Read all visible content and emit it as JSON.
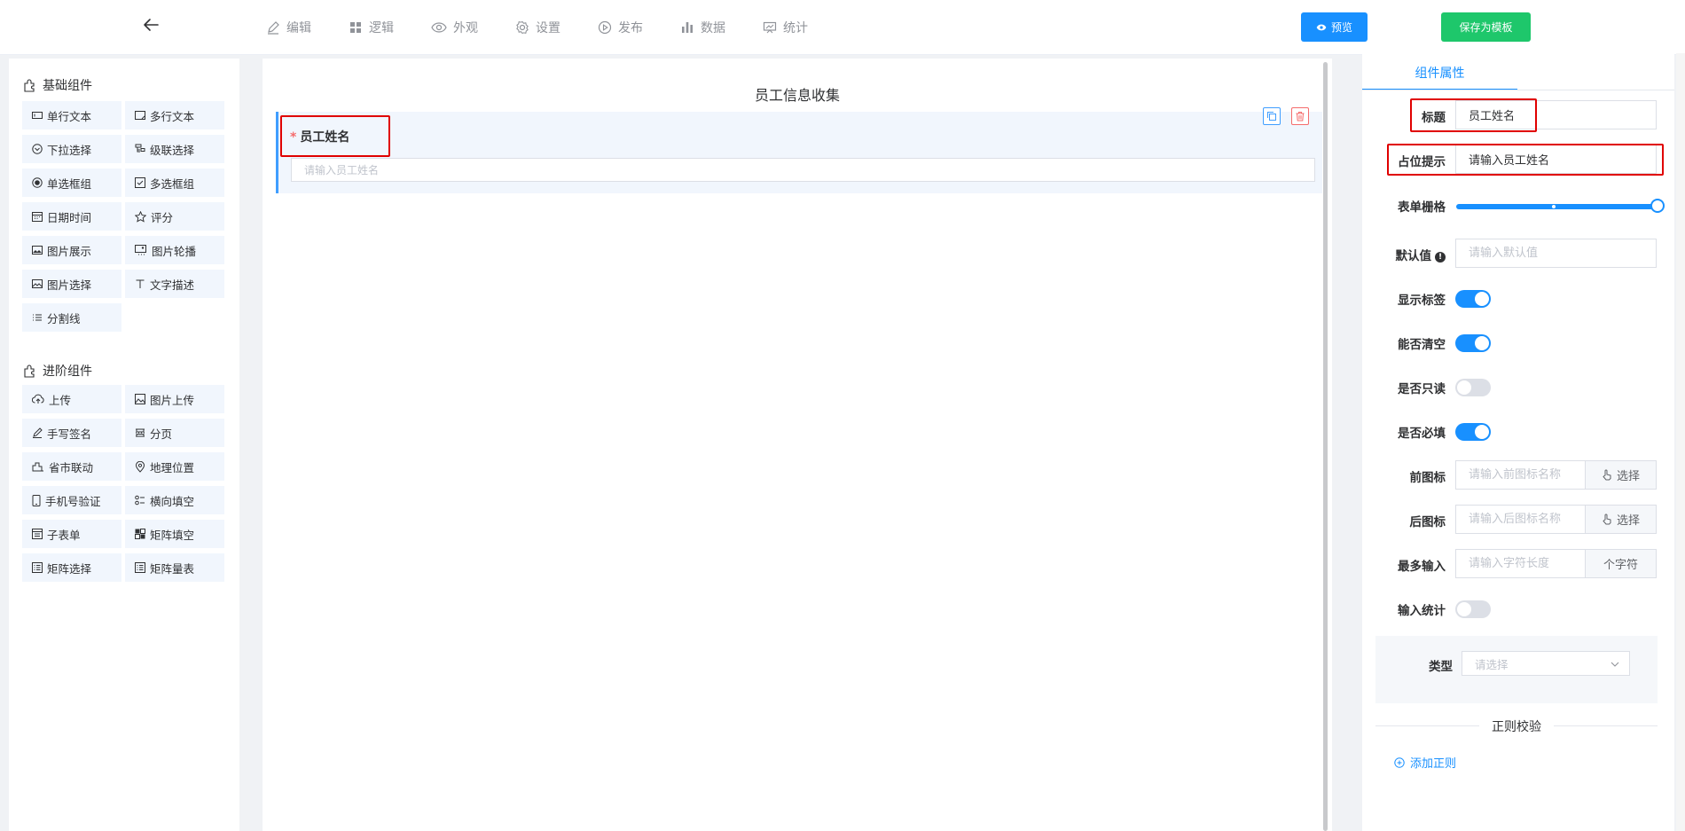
{
  "topbar": {
    "nav": [
      {
        "label": "编辑",
        "icon": "edit-icon"
      },
      {
        "label": "逻辑",
        "icon": "logic-icon"
      },
      {
        "label": "外观",
        "icon": "eye-icon"
      },
      {
        "label": "设置",
        "icon": "gear-icon"
      },
      {
        "label": "发布",
        "icon": "play-icon"
      },
      {
        "label": "数据",
        "icon": "bar-chart-icon"
      },
      {
        "label": "统计",
        "icon": "statistics-icon"
      }
    ],
    "preview_label": "预览",
    "save_template_label": "保存为模板"
  },
  "left_panel": {
    "basic": {
      "title": "基础组件",
      "items": [
        "单行文本",
        "多行文本",
        "下拉选择",
        "级联选择",
        "单选框组",
        "多选框组",
        "日期时间",
        "评分",
        "图片展示",
        "图片轮播",
        "图片选择",
        "文字描述",
        "分割线"
      ]
    },
    "advanced": {
      "title": "进阶组件",
      "items": [
        "上传",
        "图片上传",
        "手写签名",
        "分页",
        "省市联动",
        "地理位置",
        "手机号验证",
        "横向填空",
        "子表单",
        "矩阵填空",
        "矩阵选择",
        "矩阵量表"
      ]
    }
  },
  "canvas": {
    "form_title": "员工信息收集",
    "field": {
      "required_mark": "*",
      "label": "员工姓名",
      "placeholder": "请输入员工姓名"
    }
  },
  "right_panel": {
    "tab": "组件属性",
    "props": {
      "title_label": "标题",
      "title_value": "员工姓名",
      "placeholder_label": "占位提示",
      "placeholder_value": "请输入员工姓名",
      "grid_label": "表单栅格",
      "grid_value_fraction": 1.0,
      "default_label": "默认值",
      "default_placeholder": "请输入默认值",
      "show_label_label": "显示标签",
      "show_label_on": true,
      "clearable_label": "能否清空",
      "clearable_on": true,
      "readonly_label": "是否只读",
      "readonly_on": false,
      "required_label": "是否必填",
      "required_on": true,
      "prefix_icon_label": "前图标",
      "prefix_icon_placeholder": "请输入前图标名称",
      "prefix_select": "选择",
      "suffix_icon_label": "后图标",
      "suffix_icon_placeholder": "请输入后图标名称",
      "suffix_select": "选择",
      "maxlength_label": "最多输入",
      "maxlength_placeholder": "请输入字符长度",
      "maxlength_unit": "个字符",
      "count_label": "输入统计",
      "count_on": false,
      "type_label": "类型",
      "type_placeholder": "请选择",
      "regex_title": "正则校验",
      "add_rule": "添加正则"
    }
  },
  "colors": {
    "primary": "#1890ff",
    "success": "#1ec76b",
    "danger": "#f56c6c",
    "highlight_box": "#e00000"
  }
}
